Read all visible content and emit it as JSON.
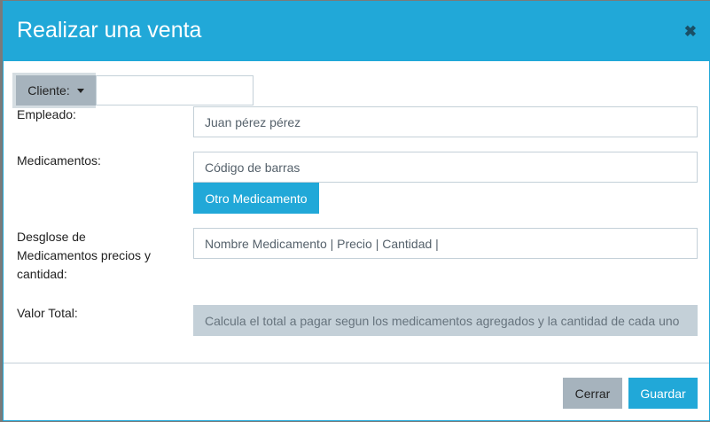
{
  "modal": {
    "title": "Realizar una venta",
    "close_icon": "close-icon"
  },
  "form": {
    "cliente_label": "Cliente:",
    "cliente_value": "",
    "empleado_label": "Empleado:",
    "empleado_value": "Juan pérez pérez",
    "medicamentos_label": "Medicamentos:",
    "medicamentos_placeholder": "Código de barras",
    "otro_button": "Otro Medicamento",
    "desglose_label_lines": [
      "Desglose de",
      "Medicamentos precios y",
      "cantidad:"
    ],
    "desglose_placeholder": "Nombre Medicamento | Precio | Cantidad |",
    "total_label": "Valor Total:",
    "total_placeholder": "Calcula el total a pagar segun los medicamentos agregados y la cantidad de cada uno"
  },
  "footer": {
    "close_button": "Cerrar",
    "save_button": "Guardar"
  },
  "colors": {
    "primary": "#21a8d8",
    "secondary": "#a6b3bd"
  }
}
